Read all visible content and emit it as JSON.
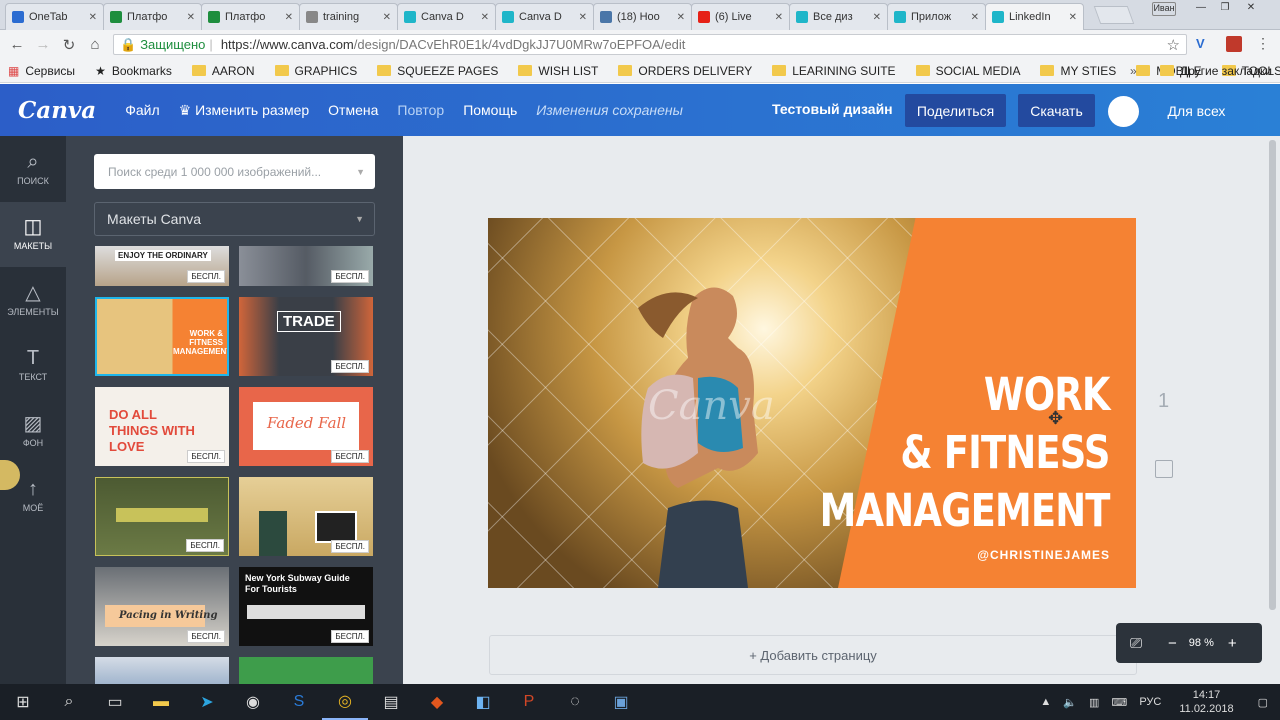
{
  "browser": {
    "tabs": [
      {
        "label": "OneTab",
        "icon": "onetab-icon",
        "color": "#2b6cd1"
      },
      {
        "label": "Платфо",
        "icon": "sheets-icon",
        "color": "#1e8e3e"
      },
      {
        "label": "Платфо",
        "icon": "sheets-icon",
        "color": "#1e8e3e"
      },
      {
        "label": "training",
        "icon": "doc-icon",
        "color": "#888888"
      },
      {
        "label": "Canva D",
        "icon": "canva-icon",
        "color": "#1fb6c9"
      },
      {
        "label": "Canva D",
        "icon": "canva-icon",
        "color": "#1fb6c9"
      },
      {
        "label": "(18) Ноо",
        "icon": "vk-icon",
        "color": "#4a76a8"
      },
      {
        "label": "(6) Live",
        "icon": "youtube-icon",
        "color": "#e62117"
      },
      {
        "label": "Все диз",
        "icon": "canva-icon",
        "color": "#1fb6c9"
      },
      {
        "label": "Прилож",
        "icon": "canva-icon",
        "color": "#1fb6c9"
      },
      {
        "label": "LinkedIn",
        "icon": "canva-icon",
        "color": "#1fb6c9"
      }
    ],
    "window_user": "Иван",
    "secure_label": "Защищено",
    "url_main": "https://www.canva.com",
    "url_path": "/design/DACvEhR0E1k/4vdDgkJJ7U0MRw7oEPFOA/edit",
    "bookmarks": [
      {
        "label": "Сервисы",
        "icon": "apps-icon"
      },
      {
        "label": "Bookmarks",
        "icon": "star-icon"
      },
      {
        "label": "AARON",
        "icon": "folder-icon"
      },
      {
        "label": "GRAPHICS",
        "icon": "folder-icon"
      },
      {
        "label": "SQUEEZE PAGES",
        "icon": "folder-icon"
      },
      {
        "label": "WISH LIST",
        "icon": "folder-icon"
      },
      {
        "label": "ORDERS DELIVERY",
        "icon": "folder-icon"
      },
      {
        "label": "LEARINING SUITE",
        "icon": "folder-icon"
      },
      {
        "label": "SOCIAL MEDIA",
        "icon": "folder-icon"
      },
      {
        "label": "MY STIES",
        "icon": "folder-icon"
      },
      {
        "label": "MOBILE",
        "icon": "folder-icon"
      },
      {
        "label": "TOOLS",
        "icon": "folder-icon"
      }
    ],
    "more_bookmarks": "»",
    "other_bookmarks": "Другие закладки"
  },
  "canva": {
    "logo": "Canva",
    "menu": {
      "file": "Файл",
      "resize": "Изменить размер",
      "undo": "Отмена",
      "redo": "Повтор",
      "help": "Помощь"
    },
    "saved": "Изменения сохранены",
    "doc_name": "Тестовый дизайн",
    "share": "Поделиться",
    "download": "Скачать",
    "visibility": "Для всех",
    "sidebar": [
      {
        "label": "ПОИСК",
        "icon": "search-icon"
      },
      {
        "label": "МАКЕТЫ",
        "icon": "layouts-icon"
      },
      {
        "label": "ЭЛЕМЕНТЫ",
        "icon": "elements-icon"
      },
      {
        "label": "ТЕКСТ",
        "icon": "text-icon"
      },
      {
        "label": "ФОН",
        "icon": "background-icon"
      },
      {
        "label": "МОЁ",
        "icon": "upload-icon"
      }
    ],
    "search_placeholder": "Поиск среди 1 000 000 изображений...",
    "layouts_dropdown": "Макеты Canva",
    "free_badge": "БЕСПЛ.",
    "thumbs": [
      {
        "text": "ENJOY THE ORDINARY"
      },
      {
        "text": ""
      },
      {
        "text": "WORK & FITNESS MANAGEMENT"
      },
      {
        "text": "TRADE"
      },
      {
        "text": "DO ALL THINGS WITH LOVE"
      },
      {
        "text": "Faded Fall"
      },
      {
        "text": ""
      },
      {
        "text": ""
      },
      {
        "text": "Pacing in Writing"
      },
      {
        "text": "New York Subway Guide For Tourists"
      }
    ],
    "design": {
      "watermark": "Canva",
      "line1": "WORK",
      "line2": "& FITNESS",
      "line3": "MANAGEMENT",
      "handle": "@CHRISTINEJAMES"
    },
    "page_number": "1",
    "add_page": "+ Добавить страницу",
    "zoom": "98 %"
  },
  "taskbar": {
    "lang": "РУС",
    "time": "14:17",
    "date": "11.02.2018"
  }
}
